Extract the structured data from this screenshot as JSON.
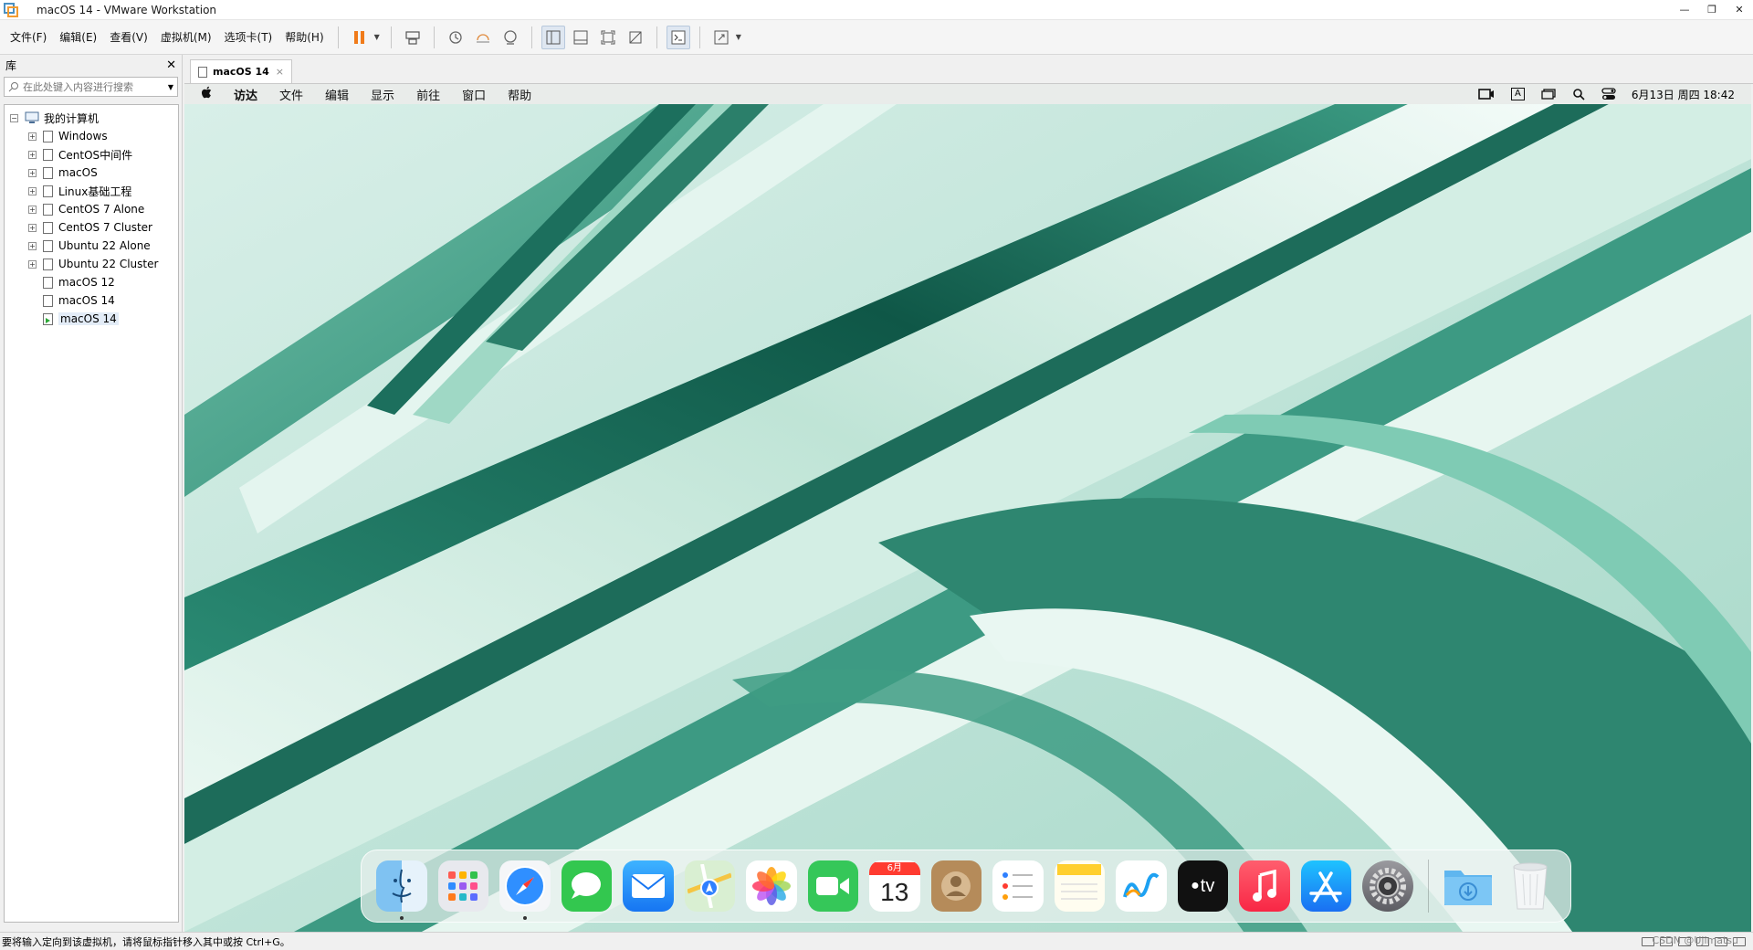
{
  "window": {
    "title": "macOS 14 - VMware Workstation"
  },
  "menubar": {
    "items": [
      "文件(F)",
      "编辑(E)",
      "查看(V)",
      "虚拟机(M)",
      "选项卡(T)",
      "帮助(H)"
    ]
  },
  "library": {
    "title": "库",
    "search_placeholder": "在此处键入内容进行搜索",
    "root": "我的计算机",
    "items": [
      {
        "label": "Windows",
        "expandable": true
      },
      {
        "label": "CentOS中间件",
        "expandable": true
      },
      {
        "label": "macOS",
        "expandable": true
      },
      {
        "label": "Linux基础工程",
        "expandable": true
      },
      {
        "label": "CentOS 7 Alone",
        "expandable": true
      },
      {
        "label": "CentOS 7 Cluster",
        "expandable": true
      },
      {
        "label": "Ubuntu 22 Alone",
        "expandable": true
      },
      {
        "label": "Ubuntu 22 Cluster",
        "expandable": true
      },
      {
        "label": "macOS 12",
        "expandable": false
      },
      {
        "label": "macOS 14",
        "expandable": false
      },
      {
        "label": "macOS 14",
        "expandable": false,
        "running": true,
        "selected": true
      }
    ]
  },
  "tabs": [
    {
      "label": "macOS 14",
      "close": "×"
    }
  ],
  "mac": {
    "menu": [
      "访达",
      "文件",
      "编辑",
      "显示",
      "前往",
      "窗口",
      "帮助"
    ],
    "clock": "6月13日 周四  18:42",
    "input_indicator": "A",
    "calendar_month": "6月",
    "calendar_day": "13",
    "tv_label": "tv",
    "dock_apps": [
      "finder",
      "launchpad",
      "safari",
      "messages",
      "mail",
      "maps",
      "photos",
      "facetime",
      "calendar",
      "contacts",
      "reminders",
      "notes",
      "freeform",
      "tv",
      "music",
      "app-store",
      "system-settings",
      "downloads",
      "trash"
    ]
  },
  "statusbar": {
    "message": "要将输入定向到该虚拟机，请将鼠标指针移入其中或按 Ctrl+G。",
    "watermark": "CSDN @Ujimatsu"
  },
  "colors": {
    "accent_pause": "#f07b1a",
    "wallpaper_dark": "#1e6e5e",
    "wallpaper_light": "#e3f4ee"
  }
}
